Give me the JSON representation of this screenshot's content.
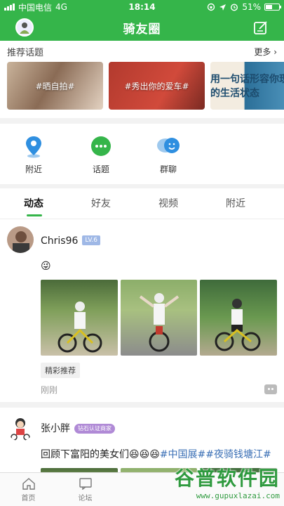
{
  "status_bar": {
    "carrier": "中国电信",
    "network": "4G",
    "time": "18:14",
    "battery": "51%",
    "battery_level": 0.51
  },
  "nav": {
    "title": "骑友圈"
  },
  "topics": {
    "heading": "推荐话题",
    "more": "更多 ›",
    "cards": [
      "#晒自拍#",
      "#秀出你的爱车#",
      "用一句话形容你现在的生活状态"
    ]
  },
  "quick": {
    "items": [
      {
        "label": "附近",
        "icon": "location-pin-icon"
      },
      {
        "label": "话题",
        "icon": "chat-bubble-icon"
      },
      {
        "label": "群聊",
        "icon": "group-chat-icon"
      }
    ]
  },
  "tabs": {
    "items": [
      "动态",
      "好友",
      "视频",
      "附近"
    ],
    "active": "动态"
  },
  "posts": [
    {
      "username": "Chris96",
      "level": "LV.6",
      "emoji": "😜",
      "tag": "精彩推荐",
      "time": "刚刚"
    },
    {
      "username": "张小胖",
      "badge": "钻石认证商家",
      "text_plain": "回顾下富阳的美女们😆😆😆",
      "text_tags": "#中国展##夜骑钱塘江#"
    }
  ],
  "bottom_bar": {
    "items": [
      {
        "label": "首页",
        "icon": "home-icon"
      },
      {
        "label": "论坛",
        "icon": "forum-icon"
      }
    ]
  },
  "watermark": {
    "logo": "谷普软件园",
    "url": "www.gupuxlazai.com"
  },
  "colors": {
    "brand_green": "#35b54a",
    "level_badge": "#9fb8e6",
    "merchant_badge": "#b08ad6",
    "tag_link": "#3a6fb5"
  }
}
